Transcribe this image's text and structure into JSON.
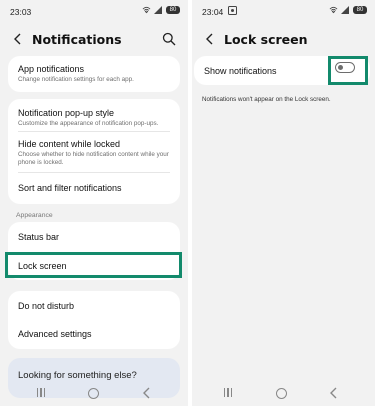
{
  "left": {
    "status": {
      "time": "23:03",
      "battery": "80"
    },
    "title": "Notifications",
    "card1": {
      "items": [
        {
          "title": "App notifications",
          "subtitle": "Change notification settings for each app."
        }
      ]
    },
    "card2": {
      "items": [
        {
          "title": "Notification pop-up style",
          "subtitle": "Customize the appearance of notification pop-ups."
        },
        {
          "title": "Hide content while locked",
          "subtitle": "Choose whether to hide notification content while your phone is locked."
        },
        {
          "title": "Sort and filter notifications",
          "subtitle": ""
        }
      ]
    },
    "section_label": "Appearance",
    "card3": {
      "items": [
        {
          "title": "Status bar"
        },
        {
          "title": "Lock screen"
        }
      ]
    },
    "card4": {
      "items": [
        {
          "title": "Do not disturb"
        },
        {
          "title": "Advanced settings"
        }
      ]
    },
    "looking": "Looking for something else?"
  },
  "right": {
    "status": {
      "time": "23:04",
      "battery": "80"
    },
    "title": "Lock screen",
    "show_notifications": {
      "label": "Show notifications",
      "enabled": false
    },
    "info": "Notifications won't appear on the Lock screen."
  },
  "colors": {
    "highlight": "#138a6c",
    "background": "#f2f2f2",
    "card": "#ffffff"
  },
  "icons": [
    "back-icon",
    "search-icon",
    "recent-apps-icon",
    "home-icon",
    "nav-back-icon"
  ]
}
